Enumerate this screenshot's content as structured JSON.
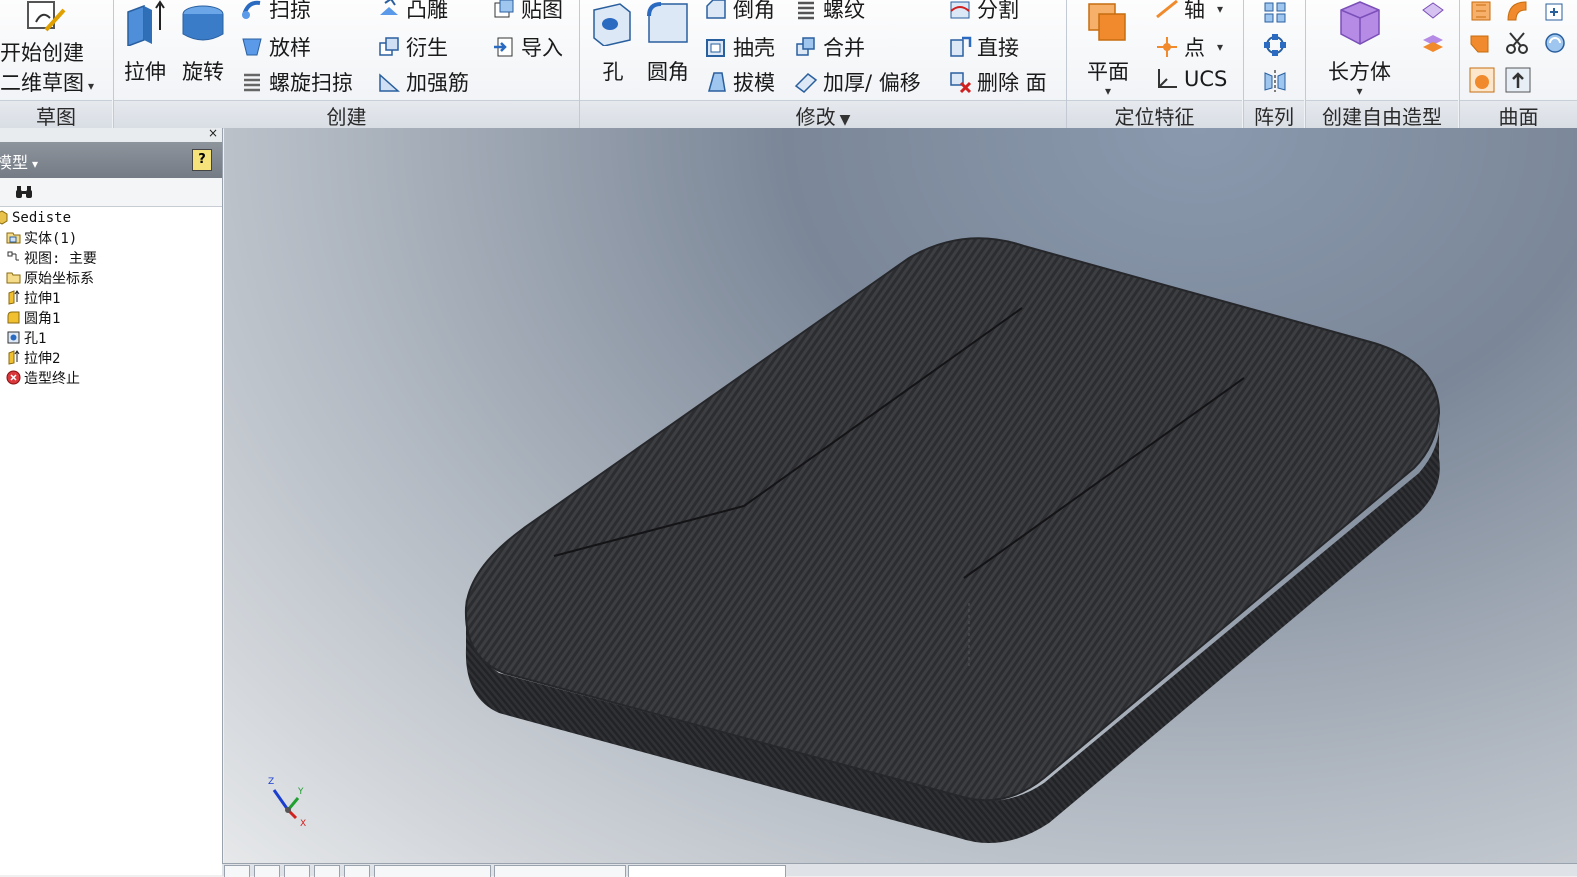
{
  "ribbon": {
    "sketch": {
      "start_label": "开始创建\n二维草图",
      "start_line1": "开始创建",
      "start_line2": "二维草图",
      "panel": "草图"
    },
    "create": {
      "panel": "创建",
      "extrude": "拉伸",
      "revolve": "旋转",
      "sweep": "扫掠",
      "loft": "放样",
      "coil": "螺旋扫掠",
      "emboss": "凸雕",
      "derive": "衍生",
      "rib": "加强筋",
      "decal": "贴图",
      "import": "导入"
    },
    "modify": {
      "panel": "修改",
      "hole": "孔",
      "fillet": "圆角",
      "chamfer": "倒角",
      "shell": "抽壳",
      "draft": "拔模",
      "thread": "螺纹",
      "combine": "合并",
      "thicken": "加厚/ 偏移",
      "split": "分割",
      "direct": "直接",
      "delete_face": "删除 面"
    },
    "work_features": {
      "panel": "定位特征",
      "plane": "平面",
      "axis": "轴",
      "point": "点",
      "ucs": "UCS"
    },
    "pattern": {
      "panel": "阵列"
    },
    "freeform": {
      "panel": "创建自由造型",
      "box": "长方体"
    },
    "surface": {
      "panel": "曲面"
    }
  },
  "browser": {
    "title": "模型",
    "help": "?",
    "close": "×",
    "tree": [
      {
        "label": "Sediste",
        "icon": "part-icon"
      },
      {
        "label": "实体(1)",
        "icon": "solid-bodies-icon"
      },
      {
        "label": "视图: 主要",
        "icon": "view-rep-icon"
      },
      {
        "label": "原始坐标系",
        "icon": "folder-icon"
      },
      {
        "label": "拉伸1",
        "icon": "extrude-icon"
      },
      {
        "label": "圆角1",
        "icon": "fillet-icon"
      },
      {
        "label": "孔1",
        "icon": "hole-icon"
      },
      {
        "label": "拉伸2",
        "icon": "extrude-icon"
      },
      {
        "label": "造型终止",
        "icon": "end-of-part-icon"
      }
    ]
  },
  "viewport": {
    "triad": {
      "x": "X",
      "y": "Y",
      "z": "Z"
    },
    "colors": {
      "model": "#3b3c40",
      "model_edge": "#2a2b2e",
      "background_top": "#7b8798",
      "background_bottom": "#e6e8ea"
    }
  }
}
